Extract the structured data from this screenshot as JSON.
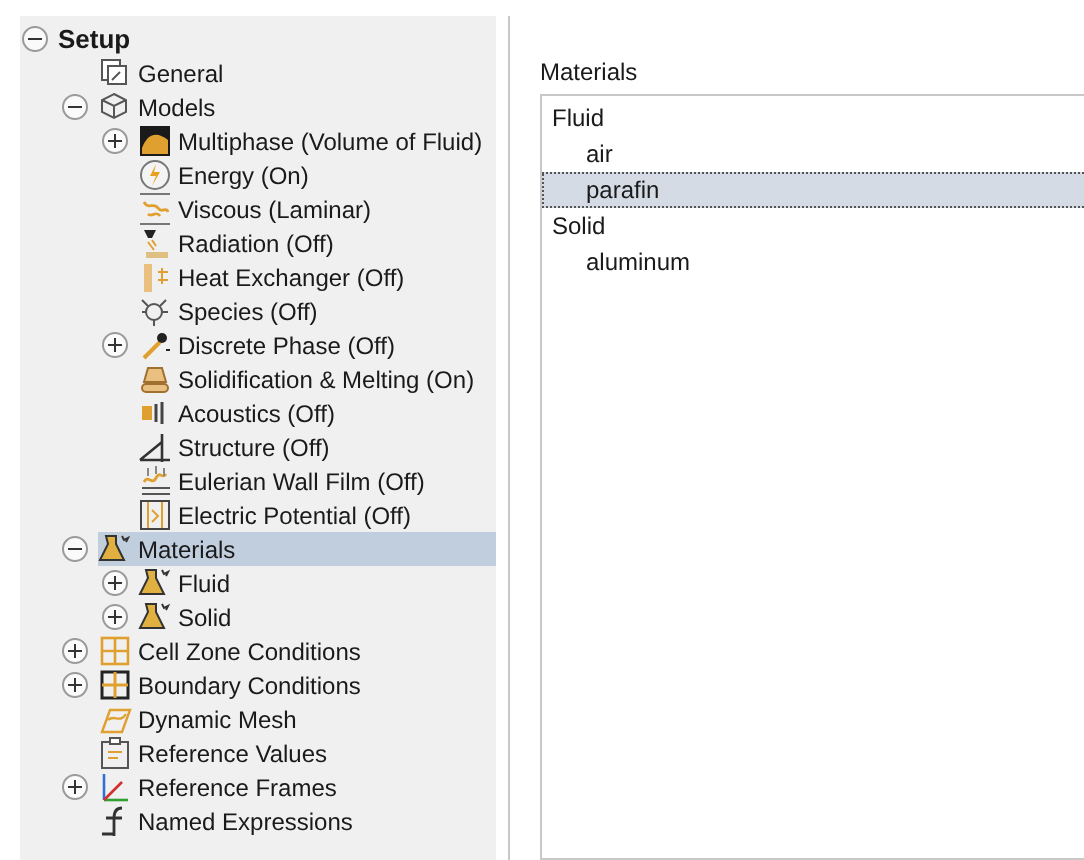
{
  "tree": [
    {
      "label": "Setup",
      "kind": "root",
      "expanded": true,
      "selected": false,
      "children": [
        {
          "label": "General",
          "kind": "general",
          "selected": false
        },
        {
          "label": "Models",
          "kind": "models",
          "expanded": true,
          "selected": false,
          "children": [
            {
              "label": "Multiphase (Volume of Fluid)",
              "kind": "multiphase",
              "expanded": false,
              "selected": false
            },
            {
              "label": "Energy (On)",
              "kind": "energy",
              "selected": false
            },
            {
              "label": "Viscous (Laminar)",
              "kind": "viscous",
              "selected": false
            },
            {
              "label": "Radiation (Off)",
              "kind": "radiation",
              "selected": false
            },
            {
              "label": "Heat Exchanger (Off)",
              "kind": "heat",
              "selected": false
            },
            {
              "label": "Species (Off)",
              "kind": "species",
              "selected": false
            },
            {
              "label": "Discrete Phase (Off)",
              "kind": "discrete",
              "expanded": false,
              "selected": false
            },
            {
              "label": "Solidification & Melting (On)",
              "kind": "solidification",
              "selected": false
            },
            {
              "label": "Acoustics (Off)",
              "kind": "acoustics",
              "selected": false
            },
            {
              "label": "Structure (Off)",
              "kind": "structure",
              "selected": false
            },
            {
              "label": "Eulerian Wall Film (Off)",
              "kind": "wallfilm",
              "selected": false
            },
            {
              "label": "Electric Potential (Off)",
              "kind": "electric",
              "selected": false
            }
          ]
        },
        {
          "label": "Materials",
          "kind": "materials",
          "expanded": true,
          "selected": true,
          "children": [
            {
              "label": "Fluid",
              "kind": "materials",
              "expanded": false,
              "selected": false
            },
            {
              "label": "Solid",
              "kind": "materials",
              "expanded": false,
              "selected": false
            }
          ]
        },
        {
          "label": "Cell Zone Conditions",
          "kind": "cellzone",
          "expanded": false,
          "selected": false
        },
        {
          "label": "Boundary Conditions",
          "kind": "boundary",
          "expanded": false,
          "selected": false
        },
        {
          "label": "Dynamic Mesh",
          "kind": "mesh",
          "selected": false
        },
        {
          "label": "Reference Values",
          "kind": "refvalues",
          "selected": false
        },
        {
          "label": "Reference Frames",
          "kind": "refframes",
          "expanded": false,
          "selected": false
        },
        {
          "label": "Named Expressions",
          "kind": "expressions",
          "selected": false
        }
      ]
    }
  ],
  "materials": {
    "label": "Materials",
    "groups": [
      {
        "label": "Fluid",
        "selected": false,
        "children": [
          {
            "label": "air",
            "selected": false
          },
          {
            "label": "parafin",
            "selected": true
          }
        ]
      },
      {
        "label": "Solid",
        "selected": false,
        "children": [
          {
            "label": "aluminum",
            "selected": false
          }
        ]
      }
    ]
  }
}
